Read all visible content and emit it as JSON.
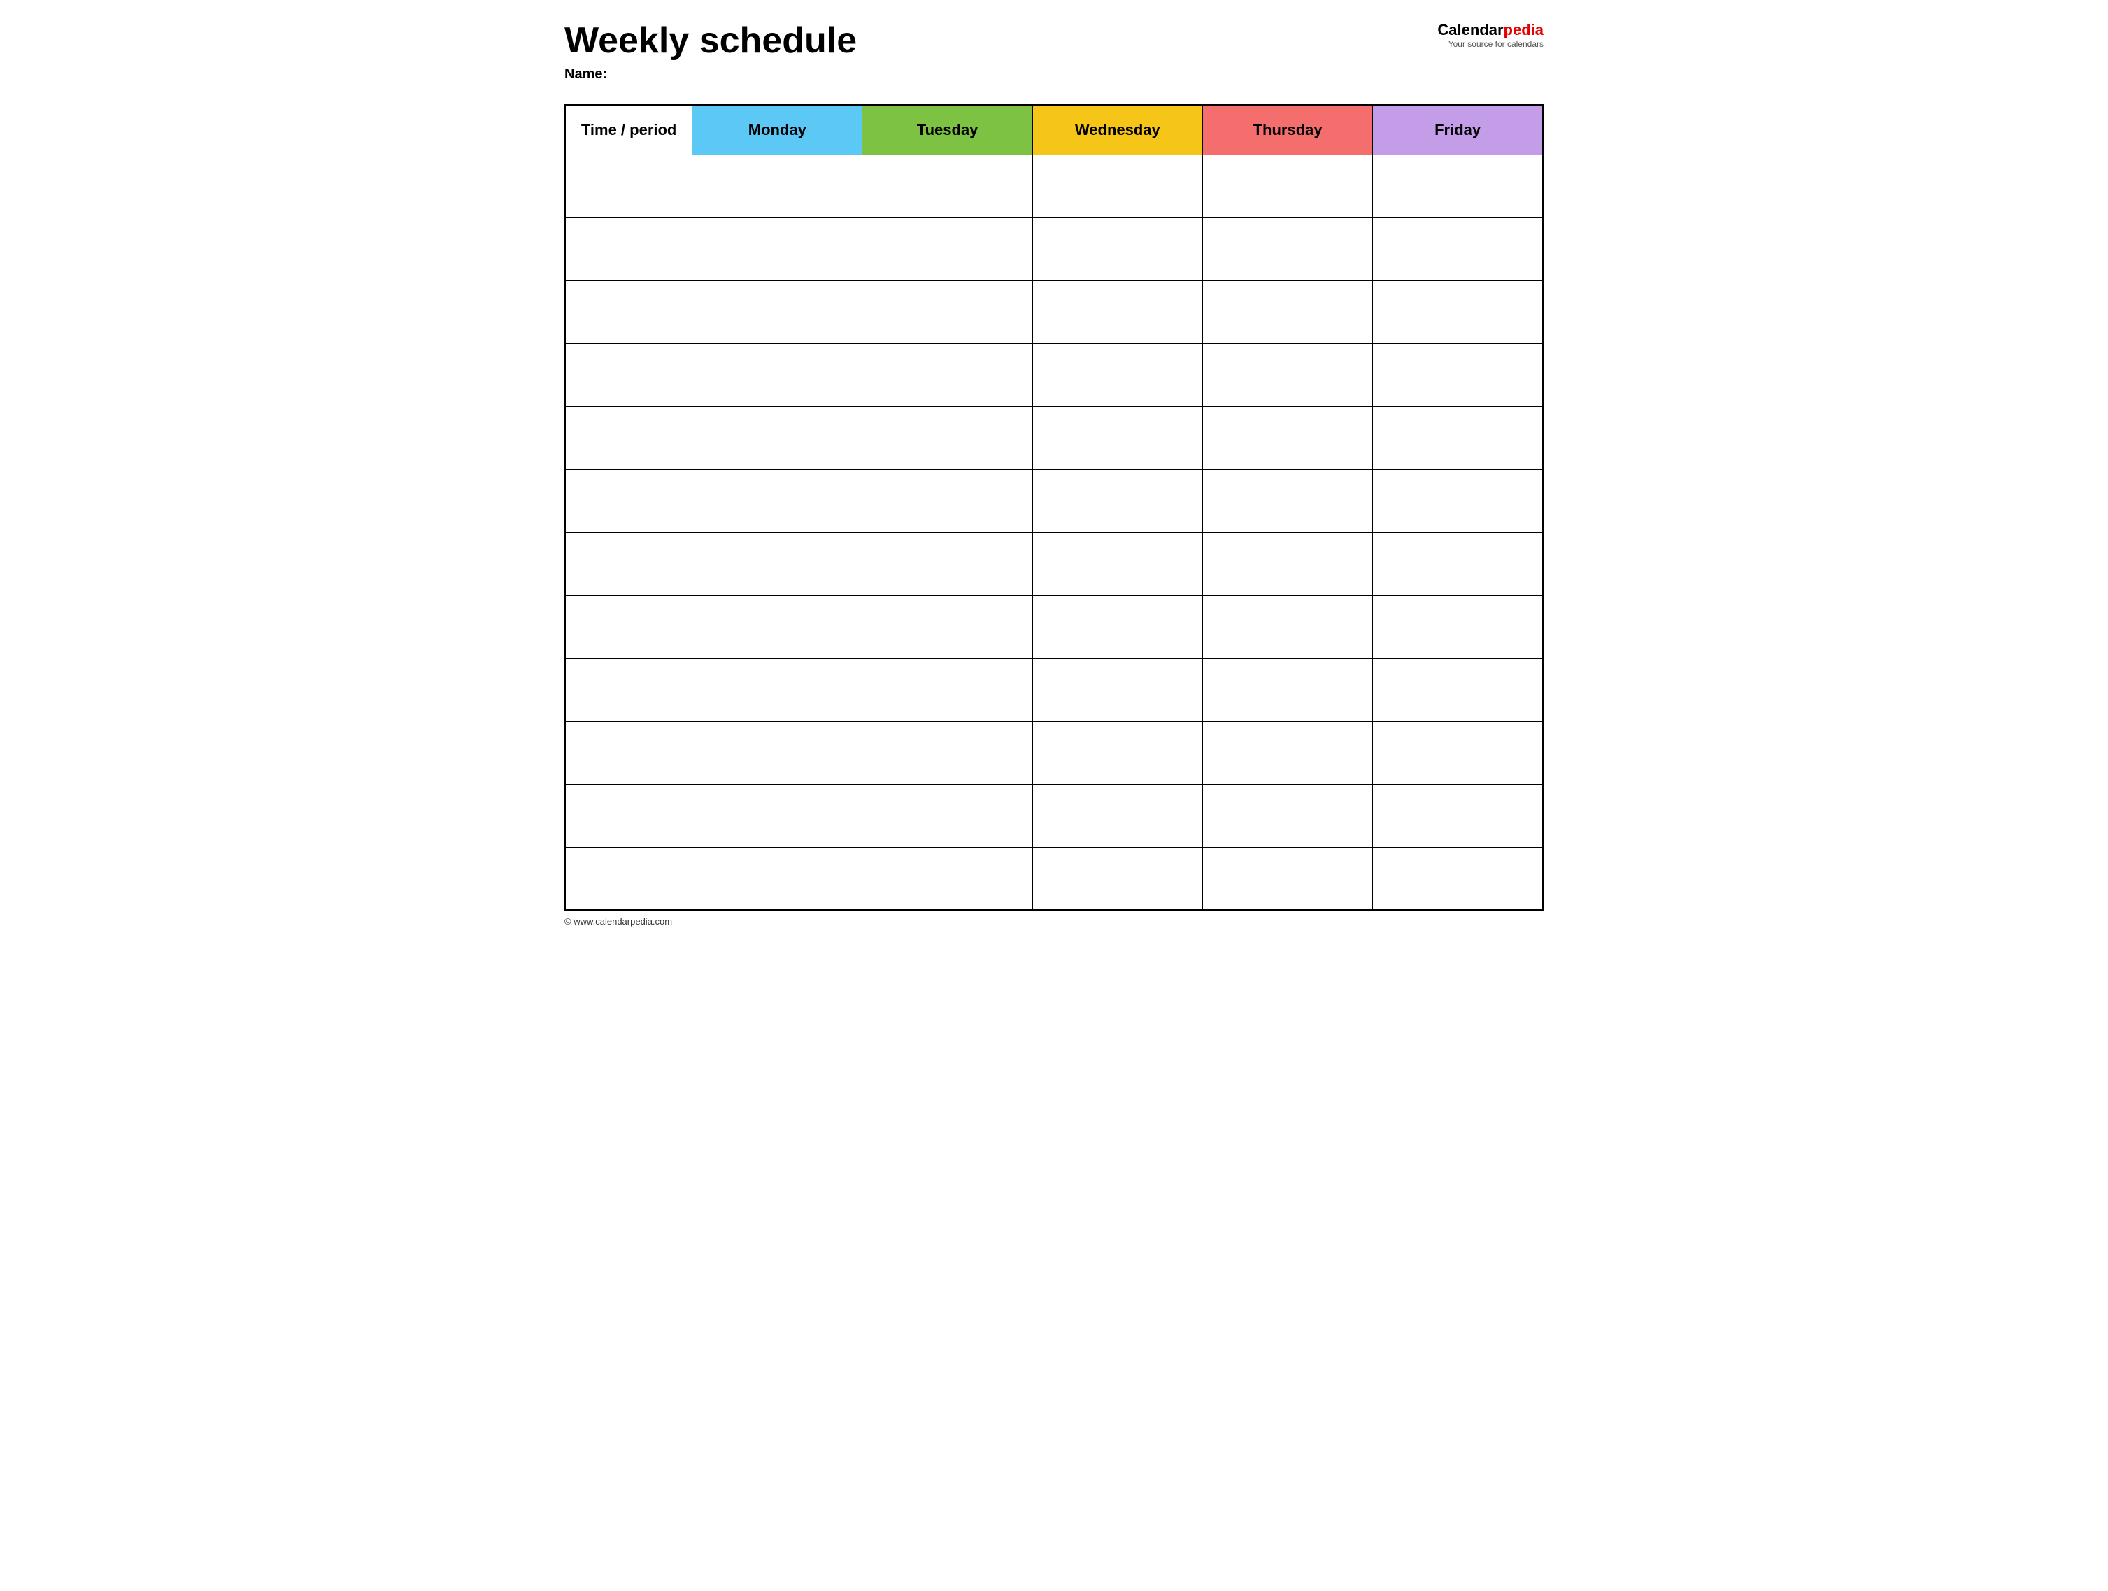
{
  "header": {
    "title": "Weekly schedule",
    "name_label": "Name:",
    "logo": {
      "calendar_part": "Calendar",
      "pedia_part": "pedia",
      "tagline": "Your source for calendars"
    }
  },
  "table": {
    "columns": [
      {
        "id": "time",
        "label": "Time / period",
        "class": "th-time"
      },
      {
        "id": "monday",
        "label": "Monday",
        "class": "th-monday"
      },
      {
        "id": "tuesday",
        "label": "Tuesday",
        "class": "th-tuesday"
      },
      {
        "id": "wednesday",
        "label": "Wednesday",
        "class": "th-wednesday"
      },
      {
        "id": "thursday",
        "label": "Thursday",
        "class": "th-thursday"
      },
      {
        "id": "friday",
        "label": "Friday",
        "class": "th-friday"
      }
    ],
    "row_count": 12
  },
  "footer": {
    "copyright": "© www.calendarpedia.com"
  }
}
